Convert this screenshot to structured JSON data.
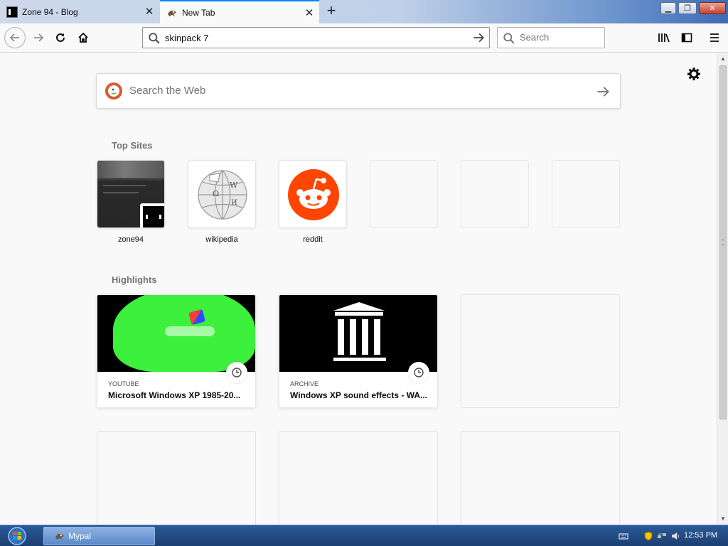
{
  "tabs": [
    {
      "title": "Zone 94 - Blog",
      "active": false
    },
    {
      "title": "New Tab",
      "active": true
    }
  ],
  "navbar": {
    "url_value": "skinpack 7 ",
    "search_placeholder": "Search"
  },
  "newtab": {
    "web_search_placeholder": "Search the Web",
    "top_sites_title": "Top Sites",
    "top_sites": [
      {
        "label": "zone94"
      },
      {
        "label": "wikipedia"
      },
      {
        "label": "reddit"
      }
    ],
    "highlights_title": "Highlights",
    "highlights": [
      {
        "source": "YOUTUBE",
        "title": "Microsoft Windows XP 1985-20..."
      },
      {
        "source": "ARCHIVE",
        "title": "Windows XP sound effects - WA..."
      }
    ]
  },
  "taskbar": {
    "task_label": "Mypal",
    "clock": "12:53 PM"
  },
  "colors": {
    "accent": "#0a84ff",
    "reddit": "#ff4500",
    "ddg": "#de5833",
    "youtube_green": "#3cf03c"
  }
}
